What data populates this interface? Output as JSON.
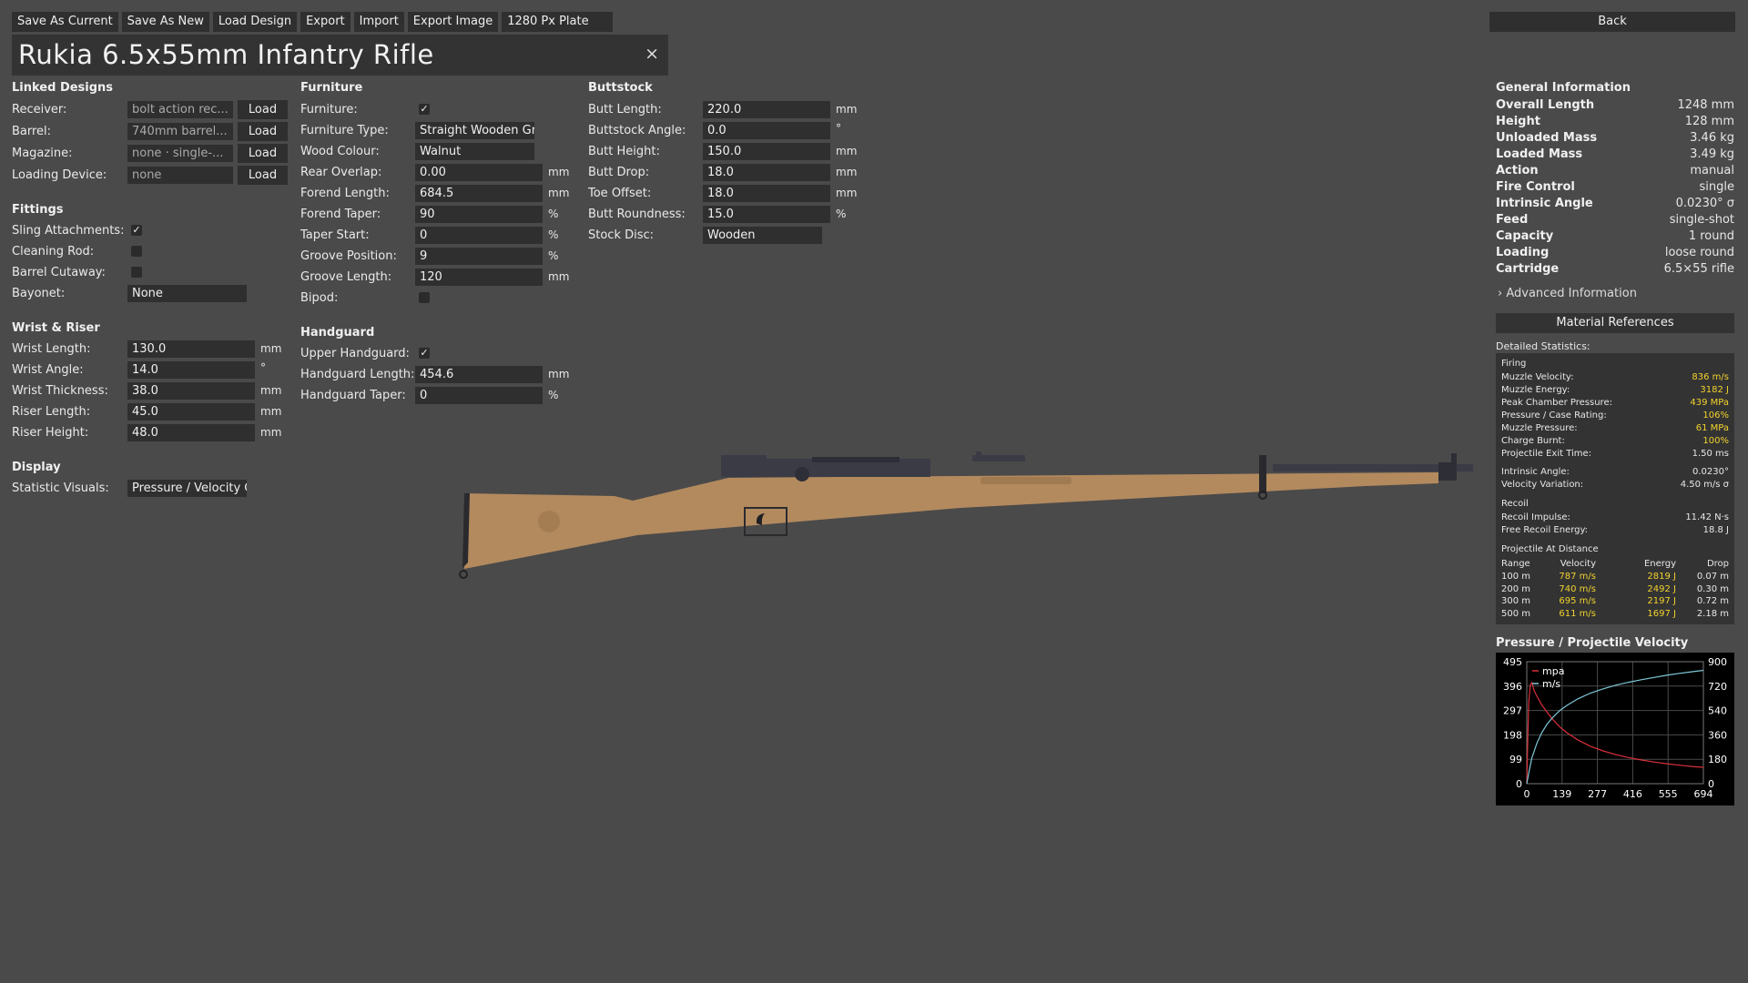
{
  "toolbar": {
    "items": [
      "Save As Current",
      "Save As New",
      "Load Design",
      "Export",
      "Import",
      "Export Image",
      "1280 Px Plate"
    ],
    "back": "Back"
  },
  "title": "Rukia 6.5x55mm Infantry Rifle",
  "close_symbol": "×",
  "linked": {
    "heading": "Linked Designs",
    "receiver_label": "Receiver:",
    "receiver_value": "bolt action rec...",
    "barrel_label": "Barrel:",
    "barrel_value": "740mm barrel...",
    "magazine_label": "Magazine:",
    "magazine_value": "none · single-...",
    "loading_label": "Loading Device:",
    "loading_value": "none",
    "load": "Load"
  },
  "fittings": {
    "heading": "Fittings",
    "sling_label": "Sling Attachments:",
    "sling": true,
    "rod_label": "Cleaning Rod:",
    "rod": false,
    "cutaway_label": "Barrel Cutaway:",
    "cutaway": false,
    "bayonet_label": "Bayonet:",
    "bayonet_value": "None"
  },
  "wrist": {
    "heading": "Wrist & Riser",
    "length_label": "Wrist Length:",
    "length": "130.0",
    "length_unit": "mm",
    "angle_label": "Wrist Angle:",
    "angle": "14.0",
    "angle_unit": "°",
    "thick_label": "Wrist Thickness:",
    "thick": "38.0",
    "thick_unit": "mm",
    "rlen_label": "Riser Length:",
    "rlen": "45.0",
    "rlen_unit": "mm",
    "rhei_label": "Riser Height:",
    "rhei": "48.0",
    "rhei_unit": "mm"
  },
  "display": {
    "heading": "Display",
    "visuals_label": "Statistic Visuals:",
    "visuals_value": "Pressure / Velocity G"
  },
  "furniture": {
    "heading": "Furniture",
    "furniture_label": "Furniture:",
    "furniture": true,
    "type_label": "Furniture Type:",
    "type_value": "Straight Wooden Gri",
    "wood_label": "Wood Colour:",
    "wood_value": "Walnut",
    "rear_label": "Rear Overlap:",
    "rear": "0.00",
    "rear_unit": "mm",
    "flen_label": "Forend Length:",
    "flen": "684.5",
    "flen_unit": "mm",
    "ftaper_label": "Forend Taper:",
    "ftaper": "90",
    "ftaper_unit": "%",
    "tstart_label": "Taper Start:",
    "tstart": "0",
    "tstart_unit": "%",
    "gpos_label": "Groove Position:",
    "gpos": "9",
    "gpos_unit": "%",
    "glen_label": "Groove Length:",
    "glen": "120",
    "glen_unit": "mm",
    "bipod_label": "Bipod:",
    "bipod": false
  },
  "handguard": {
    "heading": "Handguard",
    "upper_label": "Upper Handguard:",
    "upper": true,
    "len_label": "Handguard Length:",
    "len": "454.6",
    "len_unit": "mm",
    "taper_label": "Handguard Taper:",
    "taper": "0",
    "taper_unit": "%"
  },
  "buttstock": {
    "heading": "Buttstock",
    "blen_label": "Butt Length:",
    "blen": "220.0",
    "blen_unit": "mm",
    "bang_label": "Buttstock Angle:",
    "bang": "0.0",
    "bang_unit": "°",
    "bhei_label": "Butt Height:",
    "bhei": "150.0",
    "bhei_unit": "mm",
    "bdrop_label": "Butt Drop:",
    "bdrop": "18.0",
    "bdrop_unit": "mm",
    "toe_label": "Toe Offset:",
    "toe": "18.0",
    "toe_unit": "mm",
    "round_label": "Butt Roundness:",
    "round": "15.0",
    "round_unit": "%",
    "disc_label": "Stock Disc:",
    "disc_value": "Wooden"
  },
  "general": {
    "heading": "General Information",
    "rows": [
      {
        "k": "Overall Length",
        "v": "1248 mm"
      },
      {
        "k": "Height",
        "v": "128 mm"
      },
      {
        "k": "Unloaded Mass",
        "v": "3.46 kg"
      },
      {
        "k": "Loaded Mass",
        "v": "3.49 kg"
      },
      {
        "k": "Action",
        "v": "manual"
      },
      {
        "k": "Fire Control",
        "v": "single"
      },
      {
        "k": "Intrinsic Angle",
        "v": "0.0230° σ"
      },
      {
        "k": "Feed",
        "v": "single-shot"
      },
      {
        "k": "Capacity",
        "v": "1 round"
      },
      {
        "k": "Loading",
        "v": "loose round"
      },
      {
        "k": "Cartridge",
        "v": "6.5×55 rifle"
      }
    ],
    "advanced": "› Advanced Information",
    "material_button": "Material References"
  },
  "detailed": {
    "heading": "Detailed Statistics:",
    "firing_heading": "Firing",
    "firing": [
      {
        "k": "Muzzle Velocity:",
        "v": "836 m/s",
        "hl": true
      },
      {
        "k": "Muzzle Energy:",
        "v": "3182 J",
        "hl": true
      },
      {
        "k": "Peak Chamber Pressure:",
        "v": "439 MPa",
        "hl": true
      },
      {
        "k": "Pressure / Case Rating:",
        "v": "106%",
        "hl": true
      },
      {
        "k": "Muzzle Pressure:",
        "v": "61 MPa",
        "hl": true
      },
      {
        "k": "Charge Burnt:",
        "v": "100%",
        "hl": true
      },
      {
        "k": "Projectile Exit Time:",
        "v": "1.50 ms",
        "hl": false
      }
    ],
    "angle": [
      {
        "k": "Intrinsic Angle:",
        "v": "0.0230°",
        "hl": false
      },
      {
        "k": "Velocity Variation:",
        "v": "4.50 m/s σ",
        "hl": false
      }
    ],
    "recoil_heading": "Recoil",
    "recoil": [
      {
        "k": "Recoil Impulse:",
        "v": "11.42 N·s",
        "hl": false
      },
      {
        "k": "Free Recoil Energy:",
        "v": "18.8 J",
        "hl": false
      }
    ],
    "distance_heading": "Projectile At Distance",
    "distance_cols": [
      "Range",
      "Velocity",
      "Energy",
      "Drop"
    ],
    "distance_rows": [
      [
        "100 m",
        "787 m/s",
        "2819 J",
        "0.07 m"
      ],
      [
        "200 m",
        "740 m/s",
        "2492 J",
        "0.30 m"
      ],
      [
        "300 m",
        "695 m/s",
        "2197 J",
        "0.72 m"
      ],
      [
        "500 m",
        "611 m/s",
        "1697 J",
        "2.18 m"
      ]
    ]
  },
  "chart_data": {
    "type": "line",
    "title": "Pressure / Projectile Velocity",
    "x_ticks": [
      "0",
      "139",
      "277",
      "416",
      "555",
      "694"
    ],
    "xlim": [
      0,
      694
    ],
    "y_left_ticks": [
      "0",
      "99",
      "198",
      "297",
      "396",
      "495"
    ],
    "ylim_left": [
      0,
      495
    ],
    "y_right_ticks": [
      "0",
      "180",
      "360",
      "540",
      "720",
      "900"
    ],
    "ylim_right": [
      0,
      900
    ],
    "legend_placement": "top-left",
    "grid": true,
    "series": [
      {
        "name": "mpa",
        "axis": "left",
        "color": "#d9303a",
        "x": [
          0,
          4,
          8,
          14,
          20,
          30,
          45,
          60,
          80,
          100,
          130,
          160,
          200,
          250,
          300,
          350,
          400,
          450,
          500,
          550,
          600,
          650,
          694
        ],
        "y": [
          0,
          180,
          330,
          400,
          410,
          375,
          345,
          318,
          290,
          263,
          230,
          205,
          178,
          152,
          133,
          118,
          106,
          96,
          88,
          81,
          75,
          70,
          66
        ]
      },
      {
        "name": "m/s",
        "axis": "right",
        "color": "#7ec8d8",
        "x": [
          0,
          10,
          20,
          40,
          60,
          80,
          100,
          130,
          160,
          200,
          250,
          300,
          350,
          400,
          450,
          500,
          550,
          600,
          650,
          694
        ],
        "y": [
          0,
          100,
          190,
          300,
          380,
          440,
          485,
          540,
          580,
          625,
          668,
          700,
          727,
          748,
          767,
          784,
          800,
          814,
          826,
          836
        ]
      }
    ]
  }
}
